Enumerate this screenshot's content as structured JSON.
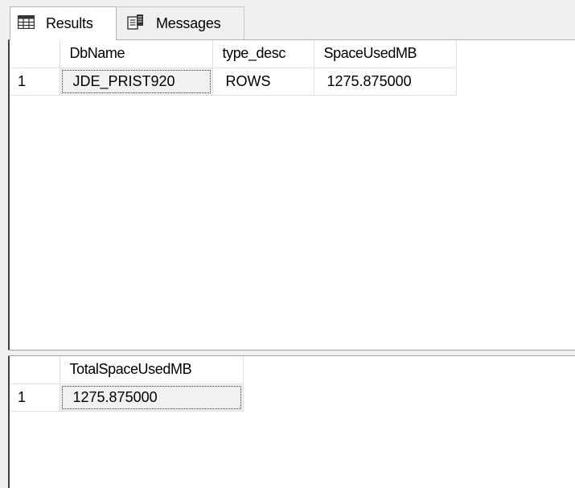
{
  "tabs": {
    "results_label": "Results",
    "messages_label": "Messages",
    "results_icon": "grid-icon",
    "messages_icon": "messages-icon"
  },
  "result1": {
    "columns": [
      "DbName",
      "type_desc",
      "SpaceUsedMB"
    ],
    "rows": [
      {
        "rownum": "1",
        "cells": [
          "JDE_PRIST920",
          "ROWS",
          "1275.875000"
        ]
      }
    ]
  },
  "result2": {
    "columns": [
      "TotalSpaceUsedMB"
    ],
    "rows": [
      {
        "rownum": "1",
        "cells": [
          "1275.875000"
        ]
      }
    ]
  }
}
